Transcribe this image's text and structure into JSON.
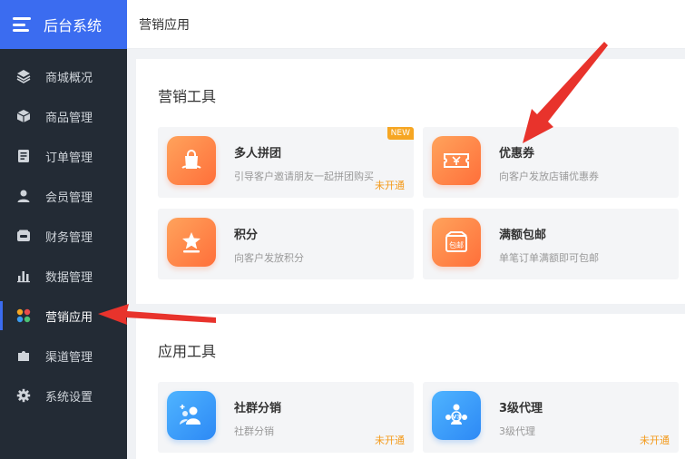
{
  "app": {
    "title": "后台系统"
  },
  "sidebar": {
    "items": [
      {
        "label": "商城概况",
        "icon": "layers-icon",
        "active": false
      },
      {
        "label": "商品管理",
        "icon": "cube-icon",
        "active": false
      },
      {
        "label": "订单管理",
        "icon": "document-icon",
        "active": false
      },
      {
        "label": "会员管理",
        "icon": "user-icon",
        "active": false
      },
      {
        "label": "财务管理",
        "icon": "wallet-icon",
        "active": false
      },
      {
        "label": "数据管理",
        "icon": "bar-chart-icon",
        "active": false
      },
      {
        "label": "营销应用",
        "icon": "apps-icon",
        "active": true
      },
      {
        "label": "渠道管理",
        "icon": "puzzle-icon",
        "active": false
      },
      {
        "label": "系统设置",
        "icon": "gear-icon",
        "active": false
      }
    ]
  },
  "header": {
    "page_title": "营销应用"
  },
  "marketing_tools": {
    "title": "营销工具",
    "cards": [
      {
        "title": "多人拼团",
        "desc": "引导客户邀请朋友一起拼团购买",
        "status": "未开通",
        "badge": "NEW",
        "icon": "shopping-bag-icon"
      },
      {
        "title": "优惠券",
        "desc": "向客户发放店铺优惠券",
        "icon": "coupon-icon"
      },
      {
        "title": "积分",
        "desc": "向客户发放积分",
        "icon": "star-icon"
      },
      {
        "title": "满额包邮",
        "desc": "单笔订单满额即可包邮",
        "icon": "free-shipping-icon",
        "icon_text": "包邮"
      }
    ]
  },
  "app_tools": {
    "title": "应用工具",
    "cards": [
      {
        "title": "社群分销",
        "desc": "社群分销",
        "status": "未开通",
        "icon": "group-icon"
      },
      {
        "title": "3级代理",
        "desc": "3级代理",
        "status": "未开通",
        "icon": "agent-v3-icon",
        "icon_text": "V3"
      }
    ]
  }
}
